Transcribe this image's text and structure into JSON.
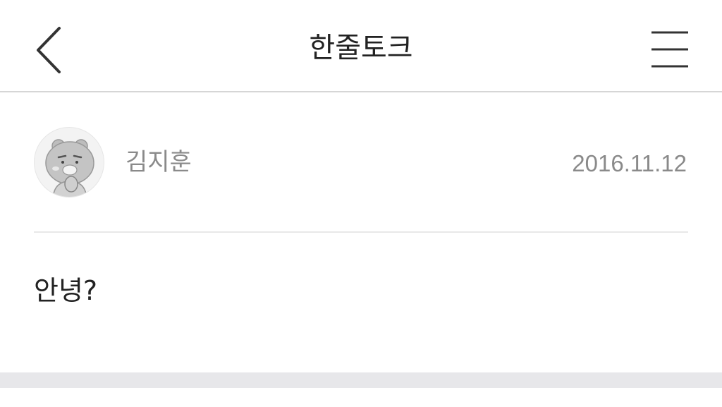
{
  "header": {
    "title": "한줄토크",
    "back_icon": "chevron-left-icon",
    "menu_icon": "hamburger-menu-icon"
  },
  "post": {
    "author": "김지훈",
    "date": "2016.11.12",
    "avatar_icon": "bear-character-avatar",
    "message": "안녕?"
  },
  "colors": {
    "text_primary": "#222222",
    "text_secondary": "#8a8a8a",
    "divider": "#e8e8e8",
    "bottom_bar": "#e7e7ea"
  }
}
